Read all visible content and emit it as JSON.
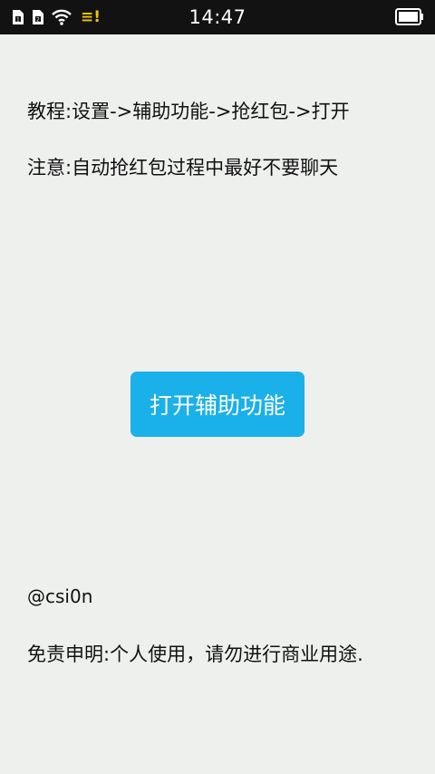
{
  "status_bar": {
    "time": "14:47",
    "notification_glyph": "≡!",
    "icons": [
      "sim-card-icon",
      "sim-card-icon",
      "wifi-icon",
      "notification-icon",
      "battery-icon"
    ],
    "notification_color": "#f2c400"
  },
  "main": {
    "tutorial_text": "教程:设置->辅助功能->抢红包->打开",
    "notice_text": "注意:自动抢红包过程中最好不要聊天",
    "open_button_label": "打开辅助功能",
    "author_text": "@csi0n",
    "disclaimer_text": "免责申明:个人使用，请勿进行商业用途."
  },
  "colors": {
    "background": "#eef0ee",
    "status_bar": "#121212",
    "button": "#1ab0ea",
    "button_text": "#ffffff",
    "text": "#111111"
  }
}
